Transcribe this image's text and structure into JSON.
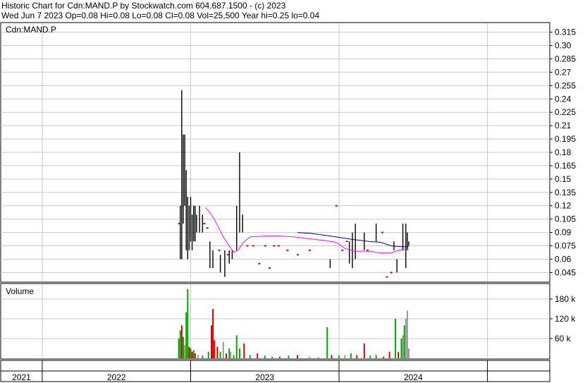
{
  "header": {
    "line1": "Historic Chart for Cdn:MAND.P by Stockwatch.com 604.687.1500 - (c) 2023",
    "line2": "Wed Jun  7 2023  Op=0.08  Hi=0.08  Lo=0.08  Cl=0.08  Vol=25,500  Year hi=0.25  lo=0.04"
  },
  "colors": {
    "price_bar": "#000000",
    "price_dot": "#cc0000",
    "ma_short": "#ff00ff",
    "ma_long": "#000099",
    "vol_up": "#00aa00",
    "vol_down": "#dd0000",
    "vol_flat": "#999999",
    "grid": "#c8c8c8"
  },
  "chart_data": [
    {
      "type": "line",
      "title": "Cdn:MAND.P",
      "y_ticks": [
        "0.315",
        "0.30",
        "0.285",
        "0.27",
        "0.255",
        "0.24",
        "0.225",
        "0.21",
        "0.195",
        "0.18",
        "0.165",
        "0.15",
        "0.135",
        "0.12",
        "0.105",
        "0.09",
        "0.075",
        "0.06",
        "0.045"
      ],
      "ylim": [
        0.035,
        0.325
      ],
      "x_ticks": [
        "2021",
        "2022",
        "2023",
        "2024"
      ],
      "xlim": [
        2020.72,
        2024.42
      ],
      "series": [
        {
          "style": "price-range",
          "points": [
            {
              "x": 2021.93,
              "lo": 0.06,
              "hi": 0.12
            },
            {
              "x": 2021.94,
              "lo": 0.06,
              "hi": 0.25
            },
            {
              "x": 2021.95,
              "lo": 0.1,
              "hi": 0.2
            },
            {
              "x": 2021.96,
              "lo": 0.12,
              "hi": 0.2
            },
            {
              "x": 2021.97,
              "lo": 0.07,
              "hi": 0.16
            },
            {
              "x": 2021.98,
              "lo": 0.06,
              "hi": 0.13
            },
            {
              "x": 2021.99,
              "lo": 0.07,
              "hi": 0.12
            },
            {
              "x": 2022.0,
              "lo": 0.08,
              "hi": 0.13
            },
            {
              "x": 2022.01,
              "lo": 0.07,
              "hi": 0.11
            },
            {
              "x": 2022.02,
              "lo": 0.08,
              "hi": 0.12
            },
            {
              "x": 2022.03,
              "lo": 0.08,
              "hi": 0.12
            },
            {
              "x": 2022.04,
              "lo": 0.09,
              "hi": 0.11
            },
            {
              "x": 2022.06,
              "lo": 0.09,
              "hi": 0.12
            },
            {
              "x": 2022.08,
              "lo": 0.09,
              "hi": 0.11
            },
            {
              "x": 2022.13,
              "lo": 0.05,
              "hi": 0.08
            },
            {
              "x": 2022.15,
              "lo": 0.05,
              "hi": 0.07
            },
            {
              "x": 2022.2,
              "lo": 0.045,
              "hi": 0.065
            },
            {
              "x": 2022.23,
              "lo": 0.04,
              "hi": 0.07
            },
            {
              "x": 2022.26,
              "lo": 0.055,
              "hi": 0.07
            },
            {
              "x": 2022.28,
              "lo": 0.06,
              "hi": 0.07
            },
            {
              "x": 2022.31,
              "lo": 0.07,
              "hi": 0.12
            },
            {
              "x": 2022.33,
              "lo": 0.09,
              "hi": 0.18
            },
            {
              "x": 2022.35,
              "lo": 0.09,
              "hi": 0.11
            },
            {
              "x": 2022.94,
              "lo": 0.05,
              "hi": 0.06
            },
            {
              "x": 2023.07,
              "lo": 0.055,
              "hi": 0.08
            },
            {
              "x": 2023.09,
              "lo": 0.05,
              "hi": 0.09
            },
            {
              "x": 2023.11,
              "lo": 0.06,
              "hi": 0.1
            },
            {
              "x": 2023.17,
              "lo": 0.07,
              "hi": 0.09
            },
            {
              "x": 2023.25,
              "lo": 0.08,
              "hi": 0.1
            },
            {
              "x": 2023.37,
              "lo": 0.07,
              "hi": 0.08
            },
            {
              "x": 2023.39,
              "lo": 0.045,
              "hi": 0.06
            },
            {
              "x": 2023.43,
              "lo": 0.07,
              "hi": 0.1
            },
            {
              "x": 2023.45,
              "lo": 0.05,
              "hi": 0.1
            },
            {
              "x": 2023.46,
              "lo": 0.07,
              "hi": 0.09
            },
            {
              "x": 2023.47,
              "lo": 0.075,
              "hi": 0.08
            }
          ]
        },
        {
          "style": "price-dot",
          "points": [
            {
              "x": 2021.92,
              "y": 0.1
            },
            {
              "x": 2022.09,
              "y": 0.1
            },
            {
              "x": 2022.11,
              "y": 0.095
            },
            {
              "x": 2022.19,
              "y": 0.07
            },
            {
              "x": 2022.25,
              "y": 0.065
            },
            {
              "x": 2022.38,
              "y": 0.075
            },
            {
              "x": 2022.42,
              "y": 0.075
            },
            {
              "x": 2022.46,
              "y": 0.055
            },
            {
              "x": 2022.5,
              "y": 0.075
            },
            {
              "x": 2022.53,
              "y": 0.05
            },
            {
              "x": 2022.56,
              "y": 0.075
            },
            {
              "x": 2022.59,
              "y": 0.075
            },
            {
              "x": 2022.65,
              "y": 0.07
            },
            {
              "x": 2022.72,
              "y": 0.065
            },
            {
              "x": 2022.8,
              "y": 0.07
            },
            {
              "x": 2022.98,
              "y": 0.12
            },
            {
              "x": 2023.02,
              "y": 0.07
            },
            {
              "x": 2023.05,
              "y": 0.08
            },
            {
              "x": 2023.19,
              "y": 0.07
            },
            {
              "x": 2023.29,
              "y": 0.09
            },
            {
              "x": 2023.32,
              "y": 0.04
            },
            {
              "x": 2023.35,
              "y": 0.045
            }
          ]
        },
        {
          "style": "ma-short",
          "points": [
            {
              "x": 2022.1,
              "y": 0.118
            },
            {
              "x": 2022.13,
              "y": 0.112
            },
            {
              "x": 2022.16,
              "y": 0.105
            },
            {
              "x": 2022.19,
              "y": 0.095
            },
            {
              "x": 2022.22,
              "y": 0.085
            },
            {
              "x": 2022.26,
              "y": 0.075
            },
            {
              "x": 2022.29,
              "y": 0.068
            },
            {
              "x": 2022.32,
              "y": 0.07
            },
            {
              "x": 2022.35,
              "y": 0.078
            },
            {
              "x": 2022.4,
              "y": 0.085
            },
            {
              "x": 2022.5,
              "y": 0.086
            },
            {
              "x": 2022.6,
              "y": 0.086
            },
            {
              "x": 2022.7,
              "y": 0.085
            },
            {
              "x": 2022.8,
              "y": 0.083
            },
            {
              "x": 2022.9,
              "y": 0.081
            },
            {
              "x": 2022.98,
              "y": 0.079
            },
            {
              "x": 2023.04,
              "y": 0.072
            },
            {
              "x": 2023.1,
              "y": 0.069
            },
            {
              "x": 2023.2,
              "y": 0.069
            },
            {
              "x": 2023.28,
              "y": 0.067
            },
            {
              "x": 2023.35,
              "y": 0.067
            },
            {
              "x": 2023.4,
              "y": 0.07
            },
            {
              "x": 2023.44,
              "y": 0.071
            },
            {
              "x": 2023.47,
              "y": 0.071
            }
          ]
        },
        {
          "style": "ma-long",
          "points": [
            {
              "x": 2022.72,
              "y": 0.09
            },
            {
              "x": 2022.8,
              "y": 0.089
            },
            {
              "x": 2022.9,
              "y": 0.087
            },
            {
              "x": 2022.98,
              "y": 0.085
            },
            {
              "x": 2023.1,
              "y": 0.082
            },
            {
              "x": 2023.2,
              "y": 0.08
            },
            {
              "x": 2023.28,
              "y": 0.079
            },
            {
              "x": 2023.35,
              "y": 0.075
            },
            {
              "x": 2023.42,
              "y": 0.074
            },
            {
              "x": 2023.47,
              "y": 0.074
            }
          ]
        }
      ]
    },
    {
      "type": "bar",
      "title": "Volume",
      "y_ticks": [
        "180 k",
        "120 k",
        "60 k"
      ],
      "y_tick_values": [
        180000,
        120000,
        60000
      ],
      "ylim": [
        0,
        225000
      ],
      "bars": [
        {
          "x": 2021.92,
          "v": 60000,
          "c": "up"
        },
        {
          "x": 2021.93,
          "v": 85000,
          "c": "up"
        },
        {
          "x": 2021.94,
          "v": 100000,
          "c": "down"
        },
        {
          "x": 2021.95,
          "v": 65000,
          "c": "up"
        },
        {
          "x": 2021.96,
          "v": 40000,
          "c": "flat"
        },
        {
          "x": 2021.97,
          "v": 140000,
          "c": "up"
        },
        {
          "x": 2021.98,
          "v": 210000,
          "c": "up"
        },
        {
          "x": 2021.99,
          "v": 35000,
          "c": "down"
        },
        {
          "x": 2022.0,
          "v": 30000,
          "c": "up"
        },
        {
          "x": 2022.01,
          "v": 20000,
          "c": "down"
        },
        {
          "x": 2022.02,
          "v": 25000,
          "c": "up"
        },
        {
          "x": 2022.03,
          "v": 15000,
          "c": "down"
        },
        {
          "x": 2022.05,
          "v": 10000,
          "c": "flat"
        },
        {
          "x": 2022.08,
          "v": 8000,
          "c": "up"
        },
        {
          "x": 2022.12,
          "v": 20000,
          "c": "up"
        },
        {
          "x": 2022.14,
          "v": 100000,
          "c": "down"
        },
        {
          "x": 2022.15,
          "v": 150000,
          "c": "down"
        },
        {
          "x": 2022.16,
          "v": 55000,
          "c": "down"
        },
        {
          "x": 2022.18,
          "v": 35000,
          "c": "down"
        },
        {
          "x": 2022.2,
          "v": 20000,
          "c": "up"
        },
        {
          "x": 2022.22,
          "v": 50000,
          "c": "flat"
        },
        {
          "x": 2022.24,
          "v": 15000,
          "c": "down"
        },
        {
          "x": 2022.26,
          "v": 30000,
          "c": "up"
        },
        {
          "x": 2022.27,
          "v": 20000,
          "c": "flat"
        },
        {
          "x": 2022.29,
          "v": 10000,
          "c": "up"
        },
        {
          "x": 2022.31,
          "v": 70000,
          "c": "up"
        },
        {
          "x": 2022.33,
          "v": 30000,
          "c": "up"
        },
        {
          "x": 2022.36,
          "v": 45000,
          "c": "down"
        },
        {
          "x": 2022.4,
          "v": 10000,
          "c": "up"
        },
        {
          "x": 2022.45,
          "v": 15000,
          "c": "down"
        },
        {
          "x": 2022.5,
          "v": 8000,
          "c": "up"
        },
        {
          "x": 2022.55,
          "v": 5000,
          "c": "up"
        },
        {
          "x": 2022.6,
          "v": 5000,
          "c": "down"
        },
        {
          "x": 2022.66,
          "v": 8000,
          "c": "up"
        },
        {
          "x": 2022.72,
          "v": 10000,
          "c": "down"
        },
        {
          "x": 2022.8,
          "v": 5000,
          "c": "flat"
        },
        {
          "x": 2022.86,
          "v": 3000,
          "c": "up"
        },
        {
          "x": 2022.92,
          "v": 95000,
          "c": "up"
        },
        {
          "x": 2022.95,
          "v": 10000,
          "c": "down"
        },
        {
          "x": 2023.0,
          "v": 8000,
          "c": "up"
        },
        {
          "x": 2023.04,
          "v": 10000,
          "c": "flat"
        },
        {
          "x": 2023.08,
          "v": 15000,
          "c": "up"
        },
        {
          "x": 2023.12,
          "v": 10000,
          "c": "down"
        },
        {
          "x": 2023.17,
          "v": 45000,
          "c": "down"
        },
        {
          "x": 2023.21,
          "v": 8000,
          "c": "up"
        },
        {
          "x": 2023.25,
          "v": 10000,
          "c": "up"
        },
        {
          "x": 2023.3,
          "v": 5000,
          "c": "down"
        },
        {
          "x": 2023.34,
          "v": 20000,
          "c": "down"
        },
        {
          "x": 2023.38,
          "v": 120000,
          "c": "up"
        },
        {
          "x": 2023.4,
          "v": 20000,
          "c": "down"
        },
        {
          "x": 2023.42,
          "v": 60000,
          "c": "up"
        },
        {
          "x": 2023.43,
          "v": 70000,
          "c": "flat"
        },
        {
          "x": 2023.44,
          "v": 100000,
          "c": "up"
        },
        {
          "x": 2023.45,
          "v": 120000,
          "c": "flat"
        },
        {
          "x": 2023.46,
          "v": 145000,
          "c": "flat"
        },
        {
          "x": 2023.47,
          "v": 30000,
          "c": "flat"
        }
      ]
    }
  ]
}
